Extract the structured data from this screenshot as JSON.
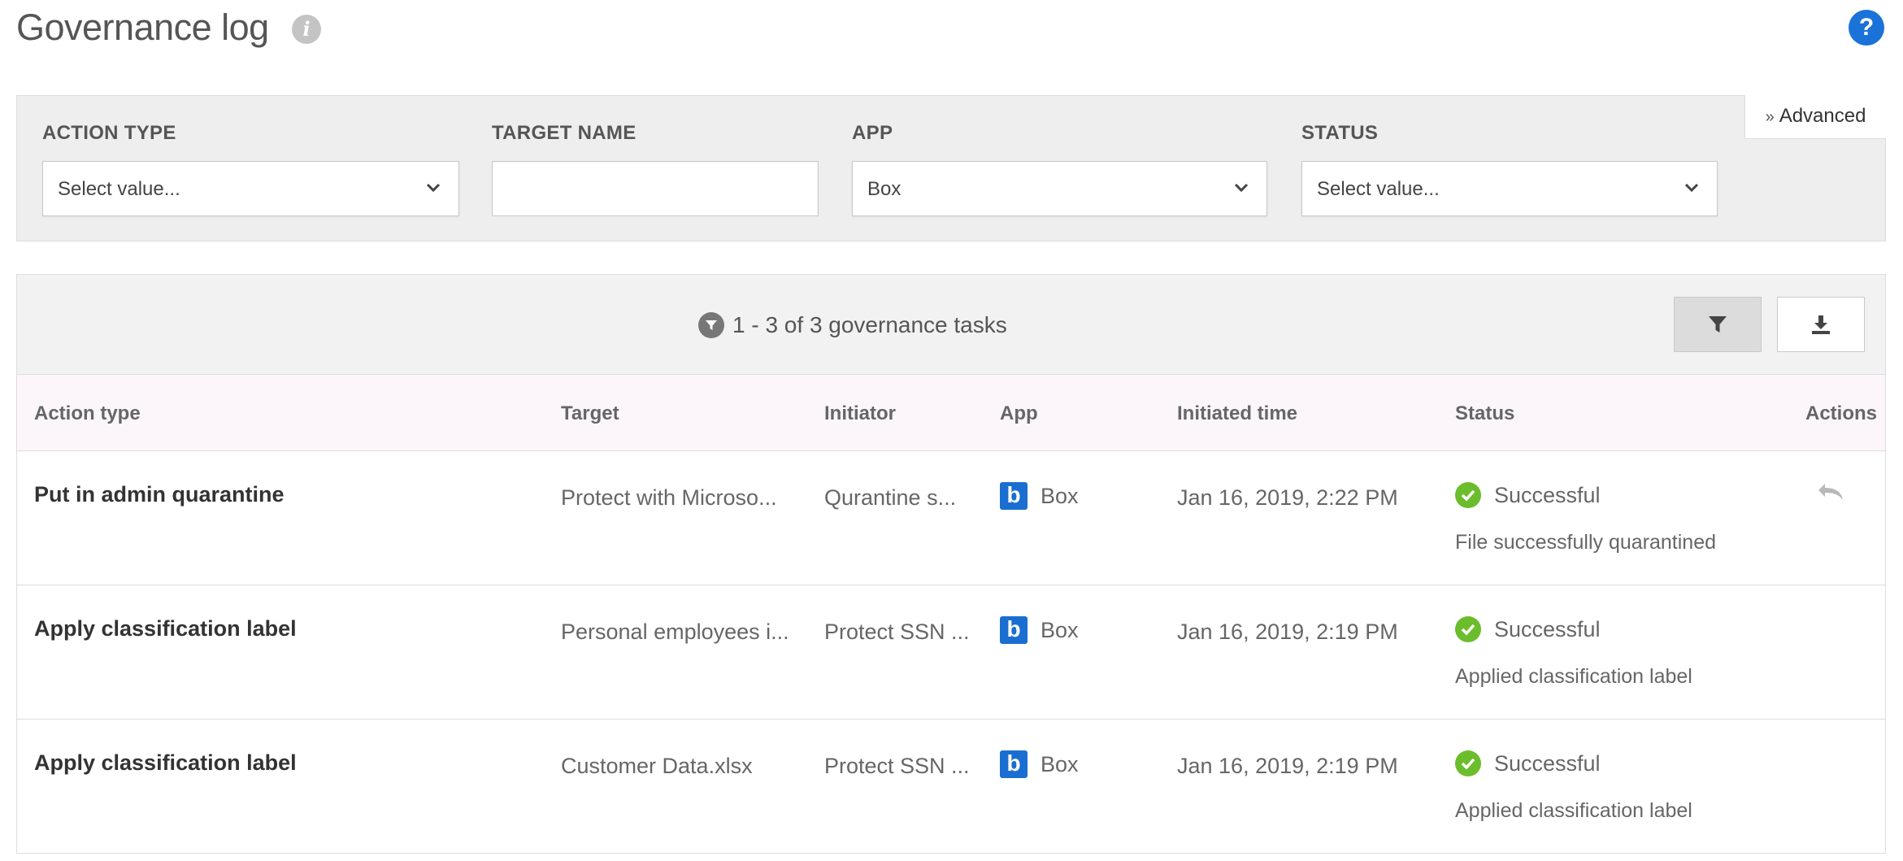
{
  "header": {
    "title": "Governance log",
    "info_icon": "info-icon",
    "help_icon": "help-icon",
    "help_glyph": "?",
    "info_glyph": "i"
  },
  "filters": {
    "action_type": {
      "label": "ACTION TYPE",
      "value": "Select value..."
    },
    "target_name": {
      "label": "TARGET NAME",
      "value": "",
      "placeholder": ""
    },
    "app": {
      "label": "APP",
      "value": "Box"
    },
    "status": {
      "label": "STATUS",
      "value": "Select value..."
    },
    "advanced_label": "Advanced"
  },
  "results": {
    "count_text": "1 - 3 of 3 governance tasks",
    "filter_button_icon": "filter-icon",
    "download_button_icon": "download-icon"
  },
  "table": {
    "columns": [
      "Action type",
      "Target",
      "Initiator",
      "App",
      "Initiated time",
      "Status",
      "Actions"
    ],
    "rows": [
      {
        "action_type": "Put in admin quarantine",
        "target": "Protect with Microso...",
        "initiator": "Qurantine s...",
        "app": "Box",
        "app_logo_letter": "b",
        "time": "Jan 16, 2019, 2:22 PM",
        "status": "Successful",
        "status_detail": "File successfully quarantined",
        "action_icon": "undo-icon"
      },
      {
        "action_type": "Apply classification label",
        "target": "Personal employees i...",
        "initiator": "Protect SSN ...",
        "app": "Box",
        "app_logo_letter": "b",
        "time": "Jan 16, 2019, 2:19 PM",
        "status": "Successful",
        "status_detail": "Applied classification label",
        "action_icon": ""
      },
      {
        "action_type": "Apply classification label",
        "target": "Customer Data.xlsx",
        "initiator": "Protect SSN ...",
        "app": "Box",
        "app_logo_letter": "b",
        "time": "Jan 16, 2019, 2:19 PM",
        "status": "Successful",
        "status_detail": "Applied classification label",
        "action_icon": ""
      }
    ]
  },
  "colors": {
    "accent_blue": "#1b72d8",
    "box_blue": "#1a6ed1",
    "success_green": "#6cbd2b",
    "header_row_bg": "#fcf6fb"
  }
}
